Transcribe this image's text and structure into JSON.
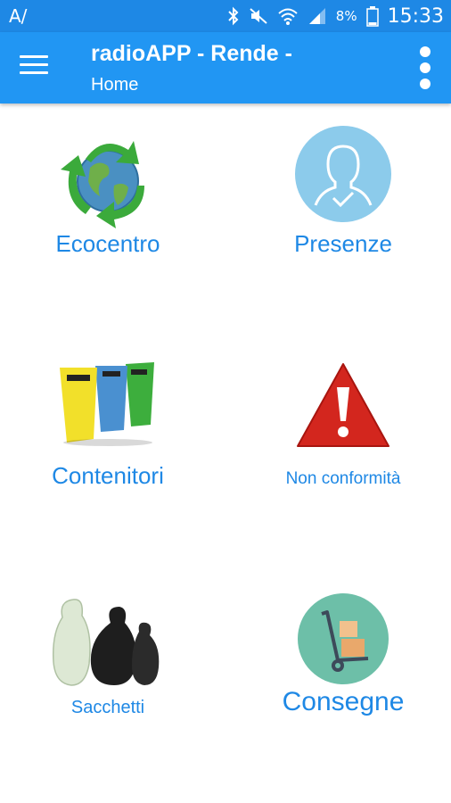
{
  "status_bar": {
    "left_icon": "A/",
    "battery_percent": "8%",
    "time": "15:33",
    "icons": [
      "bluetooth-icon",
      "mute-icon",
      "wifi-icon",
      "signal-icon",
      "battery-icon"
    ]
  },
  "app_bar": {
    "title": "radioAPP - Rende -",
    "subtitle": "Home",
    "colors": {
      "primary": "#2196F3",
      "status": "#1E88E5"
    }
  },
  "tiles": [
    {
      "label": "Ecocentro",
      "icon": "recycle-globe-icon"
    },
    {
      "label": "Presenze",
      "icon": "person-check-icon"
    },
    {
      "label": "Contenitori",
      "icon": "bins-icon"
    },
    {
      "label": "Non conformità",
      "icon": "warning-icon"
    },
    {
      "label": "Sacchetti",
      "icon": "trash-bags-icon"
    },
    {
      "label": "Consegne",
      "icon": "hand-truck-icon"
    }
  ]
}
